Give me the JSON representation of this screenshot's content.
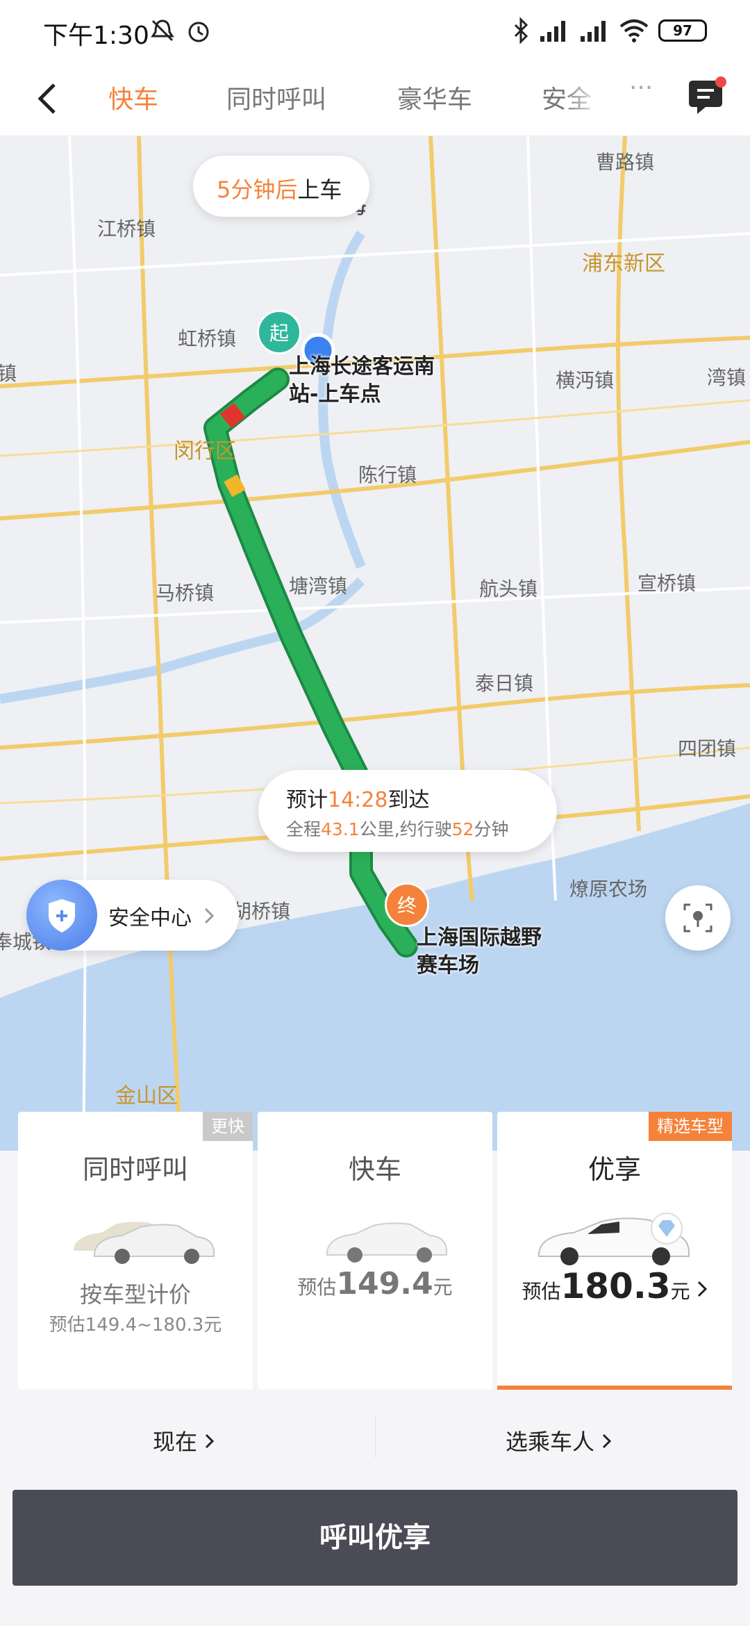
{
  "status": {
    "time": "下午1:30",
    "battery": "97"
  },
  "nav": {
    "tabs": [
      "快车",
      "同时呼叫",
      "豪华车",
      "安全"
    ],
    "active_tab": 0,
    "more": "···"
  },
  "map": {
    "places": [
      "江桥镇",
      "上海",
      "曹路镇",
      "浦东新区",
      "虹桥镇",
      "横沔镇",
      "湾镇",
      "闵行区",
      "陈行镇",
      "马桥镇",
      "塘湾镇",
      "航头镇",
      "宣桥镇",
      "泰日镇",
      "四团镇",
      "奉城镇",
      "胡桥镇",
      "燎原农场",
      "金山区",
      "镇"
    ],
    "pickup_eta": {
      "value": "5分钟后",
      "suffix": "上车"
    },
    "start_pin": "起",
    "end_pin": "终",
    "start_poi": [
      "上海长途客运南",
      "站-上车点"
    ],
    "end_poi": [
      "上海国际越野",
      "赛车场"
    ],
    "arrival": {
      "prefix": "预计",
      "time": "14:28",
      "suffix": "到达",
      "line2_a": "全程",
      "distance": "43.1",
      "line2_b": "公里,约行驶",
      "duration": "52",
      "line2_c": "分钟"
    },
    "safety_center": "安全中心"
  },
  "cards": [
    {
      "name": "同时呼叫",
      "tag": "更快",
      "line1": "按车型计价",
      "line2": "预估149.4~180.3元"
    },
    {
      "name": "快车",
      "price_prefix": "预估",
      "price": "149.4",
      "unit": "元"
    },
    {
      "name": "优享",
      "tag": "精选车型",
      "price_prefix": "预估",
      "price": "180.3",
      "unit": "元",
      "selected": true
    }
  ],
  "options": {
    "time": "现在",
    "passenger": "选乘车人"
  },
  "call_button": "呼叫优享",
  "colors": {
    "accent": "#f5823a",
    "route": "#2bb05a",
    "start_pin": "#2fb79b",
    "end_pin": "#f5823a",
    "button": "#4a4b57"
  }
}
